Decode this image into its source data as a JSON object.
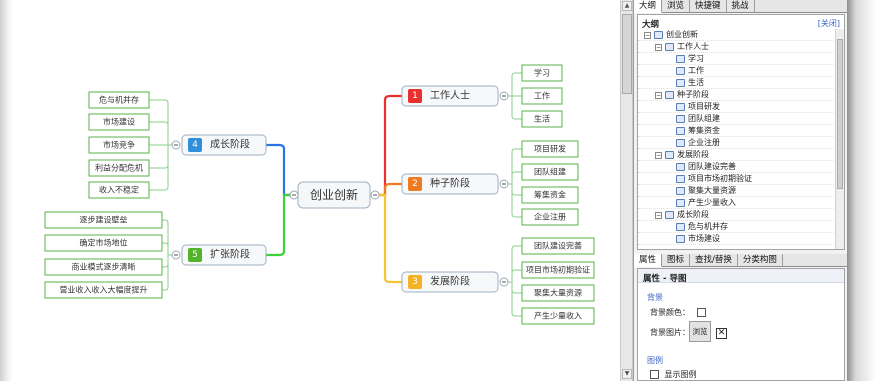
{
  "mindmap": {
    "center": "创业创新",
    "topics": [
      {
        "num": "1",
        "label": "工作人士",
        "color": "#e8312f",
        "line": "#e8312f",
        "subs": [
          "学习",
          "工作",
          "生活"
        ]
      },
      {
        "num": "2",
        "label": "种子阶段",
        "color": "#f07a22",
        "line": "#f07a22",
        "subs": [
          "项目研发",
          "团队组建",
          "筹集资金",
          "企业注册"
        ]
      },
      {
        "num": "3",
        "label": "发展阶段",
        "color": "#f4b123",
        "line": "#f6c632",
        "subs": [
          "团队建设完善",
          "项目市场初期验证",
          "聚集大量资源",
          "产生少量收入"
        ]
      },
      {
        "num": "4",
        "label": "成长阶段",
        "color": "#2f8fd8",
        "line": "#2a73e8",
        "subs": [
          "危与机并存",
          "市场建设",
          "市场竞争",
          "利益分配危机",
          "收入不稳定"
        ]
      },
      {
        "num": "5",
        "label": "扩张阶段",
        "color": "#52b42b",
        "line": "#3ed23a",
        "subs": [
          "逐步建设壁垒",
          "确定市场地位",
          "商业模式逐步清晰",
          "营业收入收入大幅度提升"
        ]
      }
    ]
  },
  "panel_tabs": [
    "大纲",
    "浏览",
    "快捷键",
    "挑战"
  ],
  "outline": {
    "title": "大纲",
    "close_label": "[关闭]",
    "rows": [
      {
        "level": 0,
        "label": "创业创新",
        "toggle": "−"
      },
      {
        "level": 1,
        "label": "工作人士",
        "toggle": "−"
      },
      {
        "level": 2,
        "label": "学习",
        "toggle": ""
      },
      {
        "level": 2,
        "label": "工作",
        "toggle": ""
      },
      {
        "level": 2,
        "label": "生活",
        "toggle": ""
      },
      {
        "level": 1,
        "label": "种子阶段",
        "toggle": "−"
      },
      {
        "level": 2,
        "label": "项目研发",
        "toggle": ""
      },
      {
        "level": 2,
        "label": "团队组建",
        "toggle": ""
      },
      {
        "level": 2,
        "label": "筹集资金",
        "toggle": ""
      },
      {
        "level": 2,
        "label": "企业注册",
        "toggle": ""
      },
      {
        "level": 1,
        "label": "发展阶段",
        "toggle": "−"
      },
      {
        "level": 2,
        "label": "团队建设完善",
        "toggle": ""
      },
      {
        "level": 2,
        "label": "项目市场初期验证",
        "toggle": ""
      },
      {
        "level": 2,
        "label": "聚集大量资源",
        "toggle": ""
      },
      {
        "level": 2,
        "label": "产生少量收入",
        "toggle": ""
      },
      {
        "level": 1,
        "label": "成长阶段",
        "toggle": "−"
      },
      {
        "level": 2,
        "label": "危与机并存",
        "toggle": ""
      },
      {
        "level": 2,
        "label": "市场建设",
        "toggle": ""
      }
    ]
  },
  "props_tabs": [
    "属性",
    "图标",
    "查找/替换",
    "分类构图"
  ],
  "props": {
    "title": "属性 - 导图",
    "section_bg": "背景",
    "bg_color_label": "背景颜色：",
    "bg_image_label": "背景图片：",
    "browse_label": "浏览",
    "clear_symbol": "✕",
    "section_legend": "图例",
    "show_legend_label": "显示图例"
  }
}
